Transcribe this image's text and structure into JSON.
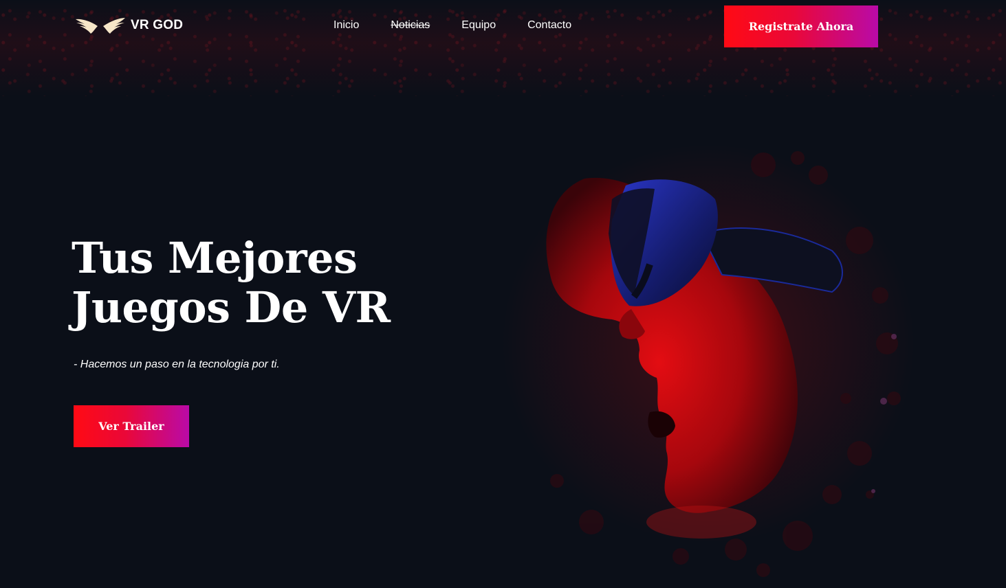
{
  "brand": {
    "name": "VR GOD",
    "logo_icon": "wings-icon",
    "logo_color": "#f7e6c8"
  },
  "nav": {
    "items": [
      {
        "label": "Inicio"
      },
      {
        "label": "Noticias"
      },
      {
        "label": "Equipo"
      },
      {
        "label": "Contacto"
      }
    ]
  },
  "header": {
    "cta_label": "Registrate Ahora"
  },
  "hero": {
    "title_line1": "Tus Mejores",
    "title_line2": "Juegos De VR",
    "subtitle": "- Hacemos un paso en la tecnologia por ti.",
    "trailer_label": "Ver Trailer",
    "image": "vr-headset-face-illustration"
  },
  "colors": {
    "background": "#0b0f18",
    "accent_start": "#ff0a14",
    "accent_end": "#b90aa8",
    "face_red": "#d40a12",
    "headset_blue": "#1e2aa8"
  }
}
